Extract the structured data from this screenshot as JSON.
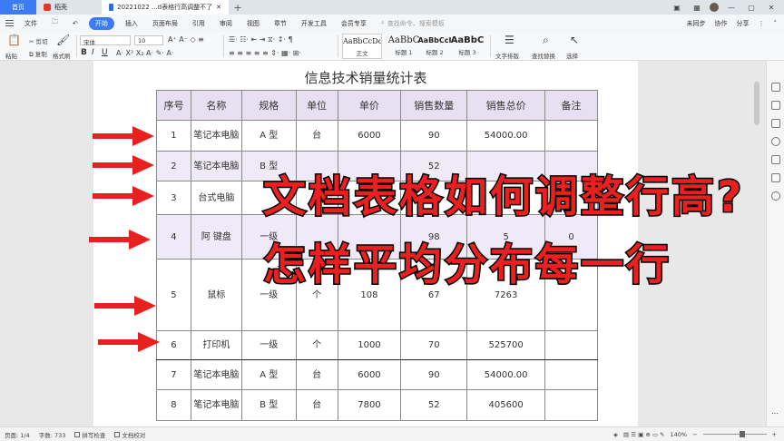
{
  "tabs": {
    "home": "首页",
    "dao": "稻壳",
    "doc": "20221022 ...d表格行高调整不了",
    "add": "+"
  },
  "window": {
    "min": "—",
    "max": "▢",
    "close": "✕"
  },
  "menu": {
    "items": [
      "文件",
      "开始",
      "插入",
      "页面布局",
      "引用",
      "审阅",
      "视图",
      "章节",
      "开发工具",
      "会员专享"
    ],
    "search": "查找命令、搜索模板",
    "right": [
      "未同步",
      "协作",
      "分享"
    ]
  },
  "ribbon": {
    "paste": "粘贴",
    "cut": "剪切",
    "copy": "复制",
    "format_painter": "格式刷",
    "font_name": "宋体",
    "font_size": "10",
    "styles": [
      {
        "sample": "AaBbCcDd",
        "name": "正文"
      },
      {
        "sample": "AaBbC",
        "name": "标题 1"
      },
      {
        "sample": "AaBbCcI",
        "name": "标题 2"
      },
      {
        "sample": "AaBbC",
        "name": "标题 3"
      }
    ],
    "text_layout": "文字排版",
    "find_replace": "查找替换",
    "select": "选择"
  },
  "document": {
    "title": "信息技术销量统计表",
    "headers": [
      "序号",
      "名称",
      "规格",
      "单位",
      "单价",
      "销售数量",
      "销售总价",
      "备注"
    ],
    "rows": [
      [
        "1",
        "笔记本电脑",
        "A 型",
        "台",
        "6000",
        "90",
        "54000.00",
        ""
      ],
      [
        "2",
        "笔记本电脑",
        "B 型",
        "",
        "",
        "52",
        "",
        ""
      ],
      [
        "3",
        "台式电脑",
        "",
        "",
        "",
        "82",
        "4",
        ""
      ],
      [
        "4",
        "阿 键盘",
        "一级",
        "",
        "",
        "98",
        "5",
        "0"
      ],
      [
        "5",
        "鼠标",
        "一级",
        "个",
        "108",
        "67",
        "7263",
        ""
      ],
      [
        "6",
        "打印机",
        "一级",
        "个",
        "1000",
        "70",
        "525700",
        ""
      ],
      [
        "7",
        "笔记本电脑",
        "A 型",
        "台",
        "6000",
        "90",
        "54000.00",
        ""
      ],
      [
        "8",
        "笔记本电脑",
        "B 型",
        "台",
        "7800",
        "52",
        "405600",
        ""
      ]
    ]
  },
  "overlay": {
    "line1": "文档表格如何调整行高?",
    "line2": "怎样平均分布每一行"
  },
  "status": {
    "page": "页面: 1/4",
    "words": "字数: 733",
    "spell": "拼写检查",
    "proof": "文档校对",
    "zoom": "140%"
  },
  "colors": {
    "accent": "#3b7cf4",
    "arrow": "#e8201f",
    "header_fill": "#e6e0f2"
  }
}
